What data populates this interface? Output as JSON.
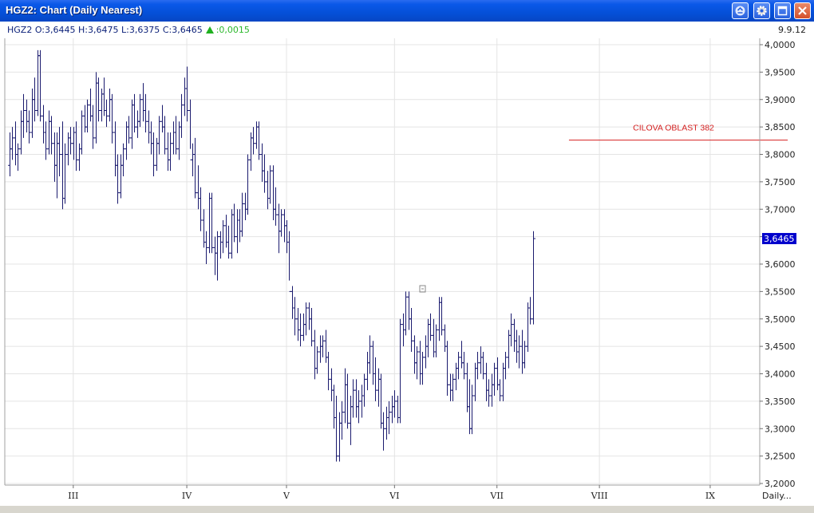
{
  "window": {
    "title": "HGZ2: Chart (Daily Nearest)",
    "buttons": [
      "help-icon",
      "settings-icon",
      "maximize-icon",
      "close-icon"
    ]
  },
  "quote": {
    "symbol": "HGZ2",
    "open": "O:3,6445",
    "high": "H:3,6475",
    "low": "L:3,6375",
    "close": "C:3,6465",
    "change": ":0,0015",
    "date": "9.9.12"
  },
  "colors": {
    "bars": "#1a1a6e",
    "annotation": "#d42020",
    "last_price_bg": "#0000cc",
    "grid": "#e4e4e4"
  },
  "chart_data": {
    "type": "ohlc",
    "yaxis": {
      "min": 3.2,
      "max": 4.0,
      "ticks": [
        4.0,
        3.95,
        3.9,
        3.85,
        3.8,
        3.75,
        3.7,
        3.65,
        3.6,
        3.55,
        3.5,
        3.45,
        3.4,
        3.35,
        3.3,
        3.25,
        3.2
      ],
      "tick_labels": [
        "4,0000",
        "3,9500",
        "3,9000",
        "3,8500",
        "3,8000",
        "3,7500",
        "3,7000",
        "3,6500",
        "3,6000",
        "3,5500",
        "3,5000",
        "3,4500",
        "3,4000",
        "3,3500",
        "3,3000",
        "3,2500",
        "3,2000"
      ]
    },
    "x_labels": [
      "III",
      "IV",
      "V",
      "VI",
      "VII",
      "VIII",
      "IX"
    ],
    "x_label_index": [
      23,
      64,
      100,
      139,
      176,
      213,
      253
    ],
    "x_axis_suffix": "Daily...",
    "last_price": 3.6465,
    "last_price_label": "3,6465",
    "annotation": {
      "text": "CILOVA OBLAST 382",
      "value": 3.826,
      "from_index": 202,
      "to_index": 281
    },
    "bars": [
      [
        3.78,
        3.84,
        3.76,
        3.81
      ],
      [
        3.81,
        3.85,
        3.79,
        3.83
      ],
      [
        3.83,
        3.86,
        3.78,
        3.8
      ],
      [
        3.8,
        3.82,
        3.77,
        3.81
      ],
      [
        3.81,
        3.88,
        3.8,
        3.86
      ],
      [
        3.86,
        3.91,
        3.83,
        3.88
      ],
      [
        3.88,
        3.9,
        3.84,
        3.86
      ],
      [
        3.86,
        3.88,
        3.82,
        3.84
      ],
      [
        3.84,
        3.92,
        3.83,
        3.9
      ],
      [
        3.9,
        3.94,
        3.86,
        3.88
      ],
      [
        3.88,
        3.99,
        3.87,
        3.98
      ],
      [
        3.98,
        3.99,
        3.86,
        3.87
      ],
      [
        3.87,
        3.89,
        3.82,
        3.84
      ],
      [
        3.84,
        3.86,
        3.79,
        3.81
      ],
      [
        3.81,
        3.88,
        3.8,
        3.86
      ],
      [
        3.86,
        3.87,
        3.8,
        3.82
      ],
      [
        3.82,
        3.84,
        3.75,
        3.78
      ],
      [
        3.78,
        3.84,
        3.72,
        3.82
      ],
      [
        3.82,
        3.85,
        3.76,
        3.8
      ],
      [
        3.8,
        3.86,
        3.7,
        3.72
      ],
      [
        3.72,
        3.82,
        3.71,
        3.8
      ],
      [
        3.8,
        3.84,
        3.78,
        3.83
      ],
      [
        3.83,
        3.85,
        3.8,
        3.82
      ],
      [
        3.82,
        3.85,
        3.79,
        3.84
      ],
      [
        3.84,
        3.86,
        3.77,
        3.79
      ],
      [
        3.79,
        3.82,
        3.77,
        3.81
      ],
      [
        3.81,
        3.88,
        3.8,
        3.87
      ],
      [
        3.87,
        3.89,
        3.84,
        3.85
      ],
      [
        3.85,
        3.9,
        3.84,
        3.89
      ],
      [
        3.89,
        3.92,
        3.86,
        3.87
      ],
      [
        3.87,
        3.89,
        3.81,
        3.83
      ],
      [
        3.83,
        3.95,
        3.82,
        3.93
      ],
      [
        3.93,
        3.94,
        3.86,
        3.88
      ],
      [
        3.88,
        3.92,
        3.86,
        3.91
      ],
      [
        3.91,
        3.94,
        3.87,
        3.88
      ],
      [
        3.88,
        3.9,
        3.85,
        3.87
      ],
      [
        3.87,
        3.92,
        3.86,
        3.9
      ],
      [
        3.9,
        3.91,
        3.82,
        3.84
      ],
      [
        3.84,
        3.86,
        3.76,
        3.78
      ],
      [
        3.78,
        3.8,
        3.71,
        3.73
      ],
      [
        3.73,
        3.8,
        3.72,
        3.78
      ],
      [
        3.78,
        3.82,
        3.76,
        3.81
      ],
      [
        3.81,
        3.86,
        3.79,
        3.85
      ],
      [
        3.85,
        3.87,
        3.82,
        3.83
      ],
      [
        3.83,
        3.9,
        3.81,
        3.89
      ],
      [
        3.89,
        3.91,
        3.84,
        3.85
      ],
      [
        3.85,
        3.88,
        3.83,
        3.86
      ],
      [
        3.86,
        3.91,
        3.85,
        3.9
      ],
      [
        3.9,
        3.93,
        3.86,
        3.88
      ],
      [
        3.88,
        3.91,
        3.84,
        3.86
      ],
      [
        3.86,
        3.88,
        3.82,
        3.84
      ],
      [
        3.84,
        3.86,
        3.8,
        3.82
      ],
      [
        3.82,
        3.84,
        3.76,
        3.78
      ],
      [
        3.78,
        3.83,
        3.77,
        3.82
      ],
      [
        3.82,
        3.87,
        3.8,
        3.86
      ],
      [
        3.86,
        3.89,
        3.84,
        3.85
      ],
      [
        3.85,
        3.87,
        3.8,
        3.81
      ],
      [
        3.81,
        3.84,
        3.77,
        3.79
      ],
      [
        3.79,
        3.84,
        3.77,
        3.82
      ],
      [
        3.82,
        3.86,
        3.8,
        3.84
      ],
      [
        3.84,
        3.87,
        3.8,
        3.81
      ],
      [
        3.81,
        3.86,
        3.79,
        3.85
      ],
      [
        3.85,
        3.91,
        3.83,
        3.89
      ],
      [
        3.89,
        3.94,
        3.87,
        3.92
      ],
      [
        3.92,
        3.96,
        3.86,
        3.88
      ],
      [
        3.88,
        3.9,
        3.81,
        3.79
      ],
      [
        3.79,
        3.82,
        3.76,
        3.8
      ],
      [
        3.8,
        3.83,
        3.72,
        3.73
      ],
      [
        3.73,
        3.78,
        3.7,
        3.72
      ],
      [
        3.72,
        3.74,
        3.66,
        3.68
      ],
      [
        3.68,
        3.7,
        3.63,
        3.64
      ],
      [
        3.64,
        3.66,
        3.6,
        3.63
      ],
      [
        3.63,
        3.73,
        3.62,
        3.72
      ],
      [
        3.72,
        3.73,
        3.62,
        3.63
      ],
      [
        3.63,
        3.65,
        3.58,
        3.62
      ],
      [
        3.62,
        3.66,
        3.57,
        3.65
      ],
      [
        3.65,
        3.66,
        3.61,
        3.64
      ],
      [
        3.64,
        3.68,
        3.62,
        3.67
      ],
      [
        3.67,
        3.69,
        3.63,
        3.64
      ],
      [
        3.64,
        3.67,
        3.61,
        3.62
      ],
      [
        3.62,
        3.7,
        3.61,
        3.69
      ],
      [
        3.69,
        3.71,
        3.64,
        3.65
      ],
      [
        3.65,
        3.7,
        3.62,
        3.68
      ],
      [
        3.68,
        3.7,
        3.64,
        3.66
      ],
      [
        3.66,
        3.73,
        3.65,
        3.71
      ],
      [
        3.71,
        3.73,
        3.68,
        3.7
      ],
      [
        3.7,
        3.8,
        3.69,
        3.79
      ],
      [
        3.79,
        3.84,
        3.77,
        3.83
      ],
      [
        3.83,
        3.85,
        3.8,
        3.82
      ],
      [
        3.82,
        3.86,
        3.81,
        3.85
      ],
      [
        3.85,
        3.86,
        3.79,
        3.8
      ],
      [
        3.8,
        3.82,
        3.75,
        3.77
      ],
      [
        3.77,
        3.8,
        3.73,
        3.75
      ],
      [
        3.75,
        3.77,
        3.7,
        3.72
      ],
      [
        3.72,
        3.78,
        3.71,
        3.77
      ],
      [
        3.77,
        3.78,
        3.68,
        3.7
      ],
      [
        3.7,
        3.74,
        3.67,
        3.69
      ],
      [
        3.69,
        3.71,
        3.62,
        3.66
      ],
      [
        3.66,
        3.7,
        3.65,
        3.69
      ],
      [
        3.69,
        3.7,
        3.64,
        3.67
      ],
      [
        3.67,
        3.68,
        3.62,
        3.64
      ],
      [
        3.64,
        3.66,
        3.57,
        3.55
      ],
      [
        3.55,
        3.56,
        3.5,
        3.52
      ],
      [
        3.52,
        3.54,
        3.47,
        3.5
      ],
      [
        3.5,
        3.52,
        3.46,
        3.48
      ],
      [
        3.48,
        3.51,
        3.45,
        3.47
      ],
      [
        3.47,
        3.51,
        3.46,
        3.49
      ],
      [
        3.49,
        3.53,
        3.47,
        3.52
      ],
      [
        3.52,
        3.53,
        3.48,
        3.5
      ],
      [
        3.5,
        3.52,
        3.45,
        3.46
      ],
      [
        3.46,
        3.48,
        3.39,
        3.41
      ],
      [
        3.41,
        3.45,
        3.4,
        3.44
      ],
      [
        3.44,
        3.47,
        3.42,
        3.45
      ],
      [
        3.45,
        3.47,
        3.43,
        3.46
      ],
      [
        3.46,
        3.48,
        3.42,
        3.43
      ],
      [
        3.43,
        3.44,
        3.37,
        3.39
      ],
      [
        3.39,
        3.41,
        3.35,
        3.37
      ],
      [
        3.37,
        3.38,
        3.3,
        3.32
      ],
      [
        3.32,
        3.36,
        3.24,
        3.25
      ],
      [
        3.25,
        3.33,
        3.24,
        3.31
      ],
      [
        3.31,
        3.35,
        3.28,
        3.33
      ],
      [
        3.33,
        3.41,
        3.31,
        3.38
      ],
      [
        3.38,
        3.4,
        3.3,
        3.31
      ],
      [
        3.31,
        3.36,
        3.27,
        3.34
      ],
      [
        3.34,
        3.39,
        3.32,
        3.37
      ],
      [
        3.37,
        3.39,
        3.32,
        3.34
      ],
      [
        3.34,
        3.37,
        3.31,
        3.35
      ],
      [
        3.35,
        3.38,
        3.32,
        3.36
      ],
      [
        3.36,
        3.4,
        3.34,
        3.39
      ],
      [
        3.39,
        3.44,
        3.37,
        3.42
      ],
      [
        3.42,
        3.47,
        3.4,
        3.45
      ],
      [
        3.45,
        3.46,
        3.38,
        3.4
      ],
      [
        3.4,
        3.43,
        3.35,
        3.37
      ],
      [
        3.37,
        3.41,
        3.34,
        3.39
      ],
      [
        3.39,
        3.4,
        3.3,
        3.31
      ],
      [
        3.31,
        3.33,
        3.26,
        3.3
      ],
      [
        3.3,
        3.34,
        3.28,
        3.32
      ],
      [
        3.32,
        3.35,
        3.29,
        3.33
      ],
      [
        3.33,
        3.36,
        3.31,
        3.34
      ],
      [
        3.34,
        3.37,
        3.32,
        3.35
      ],
      [
        3.35,
        3.36,
        3.31,
        3.32
      ],
      [
        3.32,
        3.5,
        3.31,
        3.49
      ],
      [
        3.49,
        3.51,
        3.45,
        3.48
      ],
      [
        3.48,
        3.55,
        3.47,
        3.54
      ],
      [
        3.54,
        3.55,
        3.48,
        3.5
      ],
      [
        3.5,
        3.52,
        3.44,
        3.46
      ],
      [
        3.46,
        3.47,
        3.4,
        3.42
      ],
      [
        3.42,
        3.45,
        3.39,
        3.44
      ],
      [
        3.44,
        3.46,
        3.38,
        3.4
      ],
      [
        3.4,
        3.44,
        3.38,
        3.43
      ],
      [
        3.43,
        3.47,
        3.41,
        3.45
      ],
      [
        3.45,
        3.5,
        3.43,
        3.49
      ],
      [
        3.49,
        3.51,
        3.46,
        3.47
      ],
      [
        3.47,
        3.5,
        3.43,
        3.44
      ],
      [
        3.44,
        3.49,
        3.43,
        3.48
      ],
      [
        3.48,
        3.54,
        3.46,
        3.53
      ],
      [
        3.53,
        3.54,
        3.47,
        3.48
      ],
      [
        3.48,
        3.49,
        3.44,
        3.45
      ],
      [
        3.45,
        3.46,
        3.36,
        3.38
      ],
      [
        3.38,
        3.4,
        3.35,
        3.37
      ],
      [
        3.37,
        3.4,
        3.35,
        3.39
      ],
      [
        3.39,
        3.42,
        3.37,
        3.41
      ],
      [
        3.41,
        3.44,
        3.39,
        3.43
      ],
      [
        3.43,
        3.46,
        3.41,
        3.42
      ],
      [
        3.42,
        3.44,
        3.39,
        3.4
      ],
      [
        3.4,
        3.42,
        3.33,
        3.34
      ],
      [
        3.34,
        3.39,
        3.29,
        3.3
      ],
      [
        3.3,
        3.38,
        3.29,
        3.36
      ],
      [
        3.36,
        3.42,
        3.35,
        3.41
      ],
      [
        3.41,
        3.44,
        3.39,
        3.42
      ],
      [
        3.42,
        3.45,
        3.4,
        3.43
      ],
      [
        3.43,
        3.44,
        3.39,
        3.4
      ],
      [
        3.4,
        3.42,
        3.35,
        3.37
      ],
      [
        3.37,
        3.39,
        3.34,
        3.36
      ],
      [
        3.36,
        3.4,
        3.34,
        3.38
      ],
      [
        3.38,
        3.42,
        3.36,
        3.41
      ],
      [
        3.41,
        3.43,
        3.37,
        3.38
      ],
      [
        3.38,
        3.39,
        3.35,
        3.36
      ],
      [
        3.36,
        3.42,
        3.35,
        3.41
      ],
      [
        3.41,
        3.44,
        3.39,
        3.43
      ],
      [
        3.43,
        3.48,
        3.41,
        3.47
      ],
      [
        3.47,
        3.51,
        3.45,
        3.49
      ],
      [
        3.49,
        3.5,
        3.44,
        3.46
      ],
      [
        3.46,
        3.48,
        3.42,
        3.44
      ],
      [
        3.44,
        3.47,
        3.41,
        3.45
      ],
      [
        3.45,
        3.48,
        3.4,
        3.42
      ],
      [
        3.42,
        3.46,
        3.41,
        3.45
      ],
      [
        3.45,
        3.53,
        3.44,
        3.52
      ],
      [
        3.52,
        3.54,
        3.49,
        3.5
      ],
      [
        3.5,
        3.66,
        3.49,
        3.6465
      ]
    ]
  }
}
